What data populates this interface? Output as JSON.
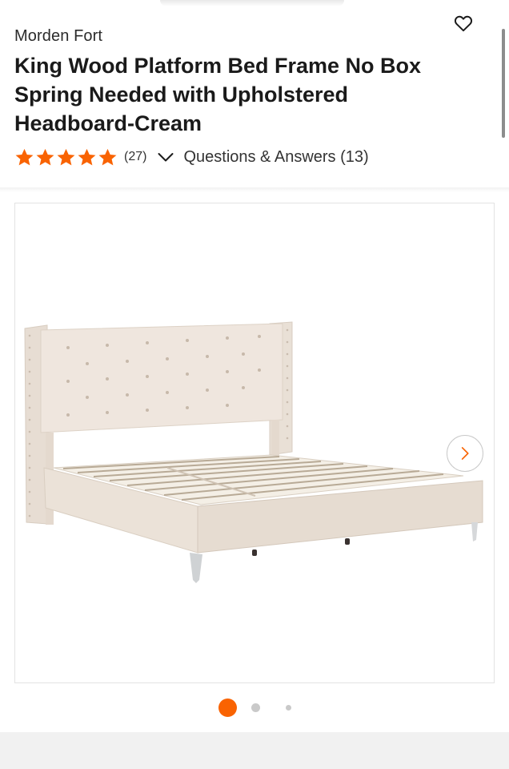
{
  "product": {
    "brand": "Morden Fort",
    "title": "King Wood Platform Bed Frame No Box Spring Needed with Upholstered Headboard-Cream"
  },
  "rating": {
    "stars": 5,
    "max_stars": 5,
    "review_count": "(27)",
    "qa_label": "Questions & Answers (13)"
  },
  "gallery": {
    "image_index": 1,
    "image_count": 3
  },
  "icons": {
    "favorite": "heart-outline-icon",
    "expand": "chevron-down-icon",
    "next": "chevron-right-icon",
    "star": "star-icon"
  },
  "colors": {
    "accent": "#f96302",
    "text": "#1b1b1b",
    "dot_inactive": "#c9c9c9",
    "bed_cream": "#efe6de"
  }
}
